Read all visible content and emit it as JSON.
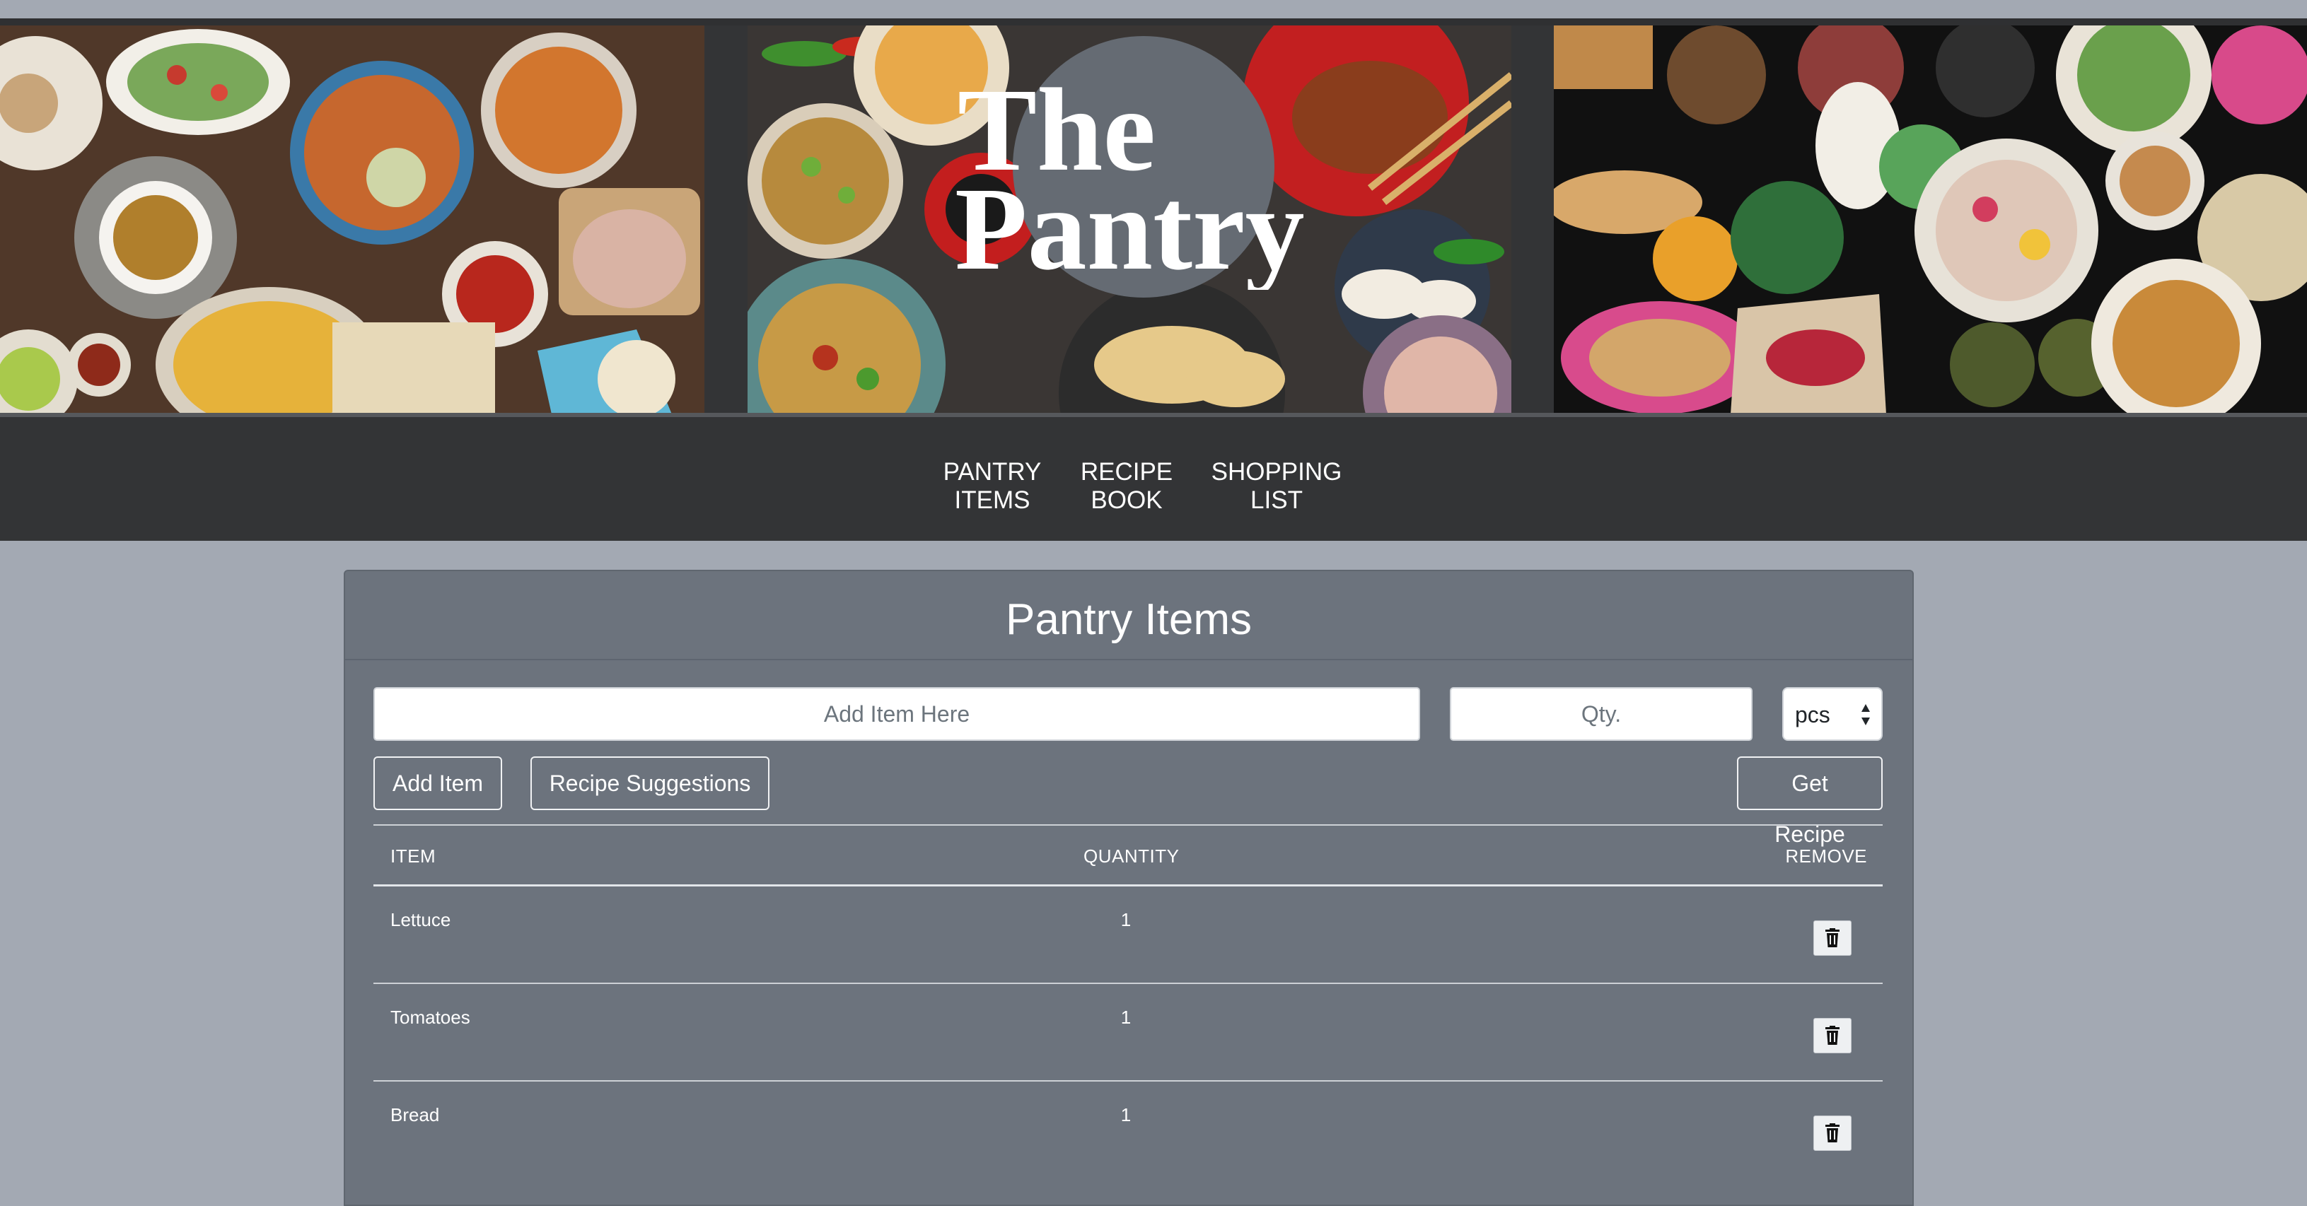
{
  "brand": {
    "logo_text": "The Pantry"
  },
  "hero": {
    "images": [
      "food-photo-left",
      "food-photo-center",
      "food-photo-right"
    ]
  },
  "nav": {
    "items": [
      {
        "line1": "Pantry",
        "line2": "Items"
      },
      {
        "line1": "Recipe",
        "line2": "Book"
      },
      {
        "line1": "Shopping",
        "line2": "List"
      }
    ]
  },
  "pantry": {
    "title": "Pantry Items",
    "item_placeholder": "Add Item Here",
    "qty_placeholder": "Qty.",
    "unit_selected": "pcs",
    "add_label": "Add Item",
    "suggest_label": "Recipe Suggestions",
    "get_recipe_label": "Get Recipe",
    "columns": {
      "item": "Item",
      "quantity": "Quantity",
      "remove": "Remove"
    },
    "rows": [
      {
        "name": "Lettuce",
        "qty": "1"
      },
      {
        "name": "Tomatoes",
        "qty": "1"
      },
      {
        "name": "Bread",
        "qty": "1"
      }
    ]
  },
  "icons": {
    "remove": "trash-icon",
    "select": "updown-arrows-icon"
  },
  "colors": {
    "page_bg": "#a3a9b3",
    "header_bg": "#333436",
    "card_bg": "#6c737d",
    "logo_circle": "#656b73"
  }
}
